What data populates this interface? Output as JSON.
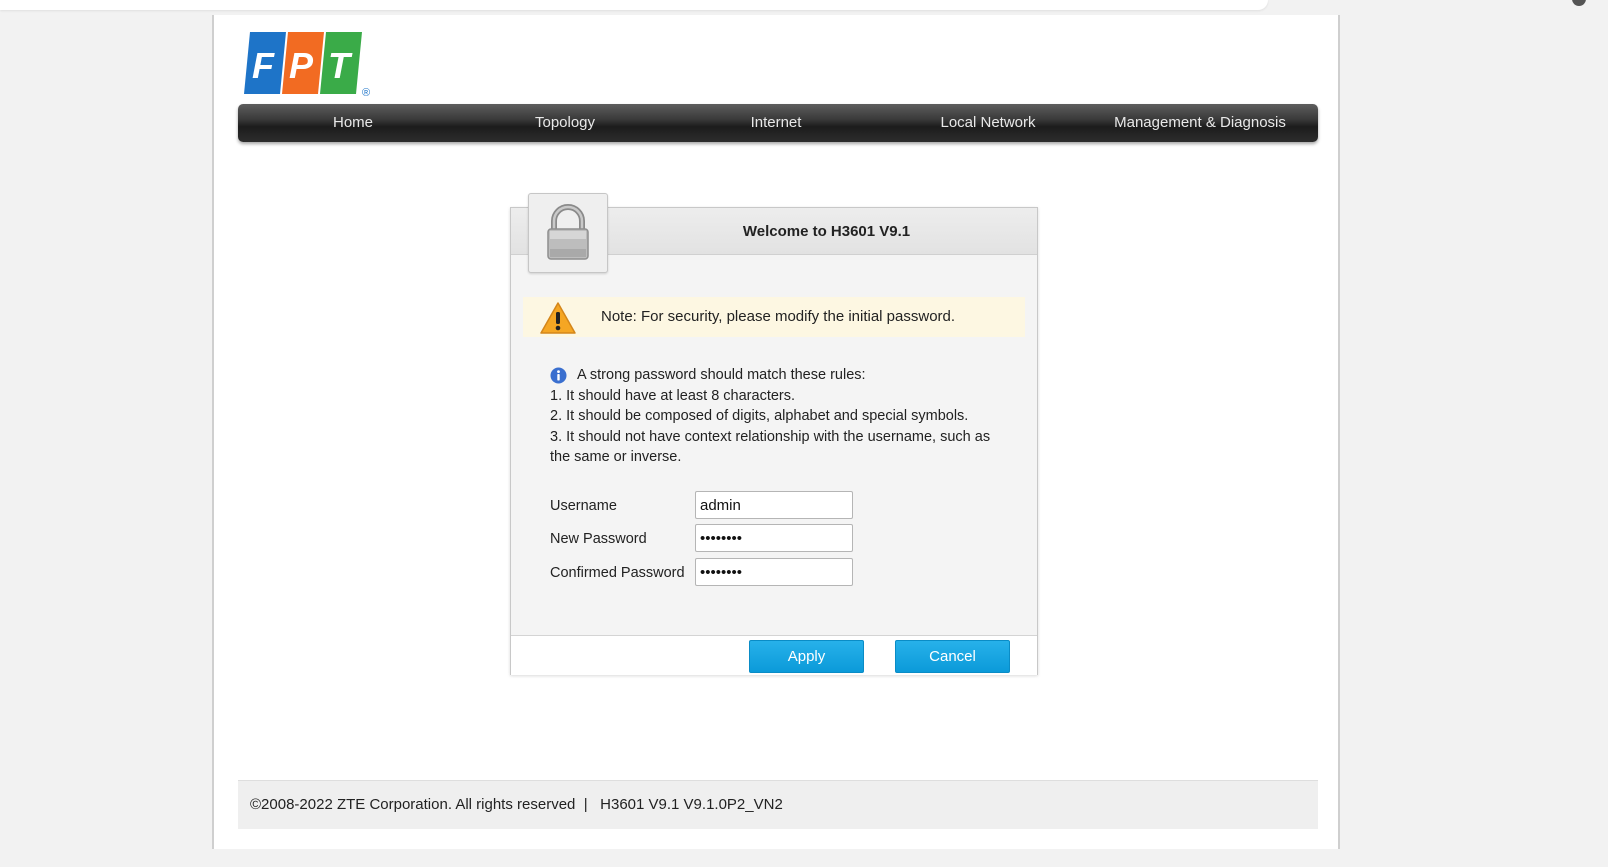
{
  "brand": {
    "logo_letters": [
      "F",
      "P",
      "T"
    ],
    "logo_mark": "®",
    "colors": [
      "#1e74c8",
      "#f26b22",
      "#3aab48"
    ]
  },
  "nav": {
    "items": [
      "Home",
      "Topology",
      "Internet",
      "Local Network",
      "Management & Diagnosis"
    ]
  },
  "dialog": {
    "title": "Welcome to H3601 V9.1",
    "icon": "lock-icon",
    "note": "Note: For security, please modify the initial password.",
    "rules": {
      "heading": "A strong password should match these rules:",
      "items": [
        "1. It should have at least 8 characters.",
        "2. It should be composed of digits, alphabet and special symbols.",
        "3. It should not have context relationship with the username, such as the same or inverse."
      ]
    },
    "fields": {
      "username": {
        "label": "Username",
        "value": "admin"
      },
      "new_password": {
        "label": "New Password",
        "value": "••••••••"
      },
      "confirm_password": {
        "label": "Confirmed Password",
        "value": "••••••••"
      }
    },
    "buttons": {
      "apply": "Apply",
      "cancel": "Cancel"
    },
    "accent_color": "#0b9ad9"
  },
  "footer": {
    "copyright": "©2008-2022 ZTE Corporation. All rights reserved",
    "separator": "|",
    "version": "H3601 V9.1 V9.1.0P2_VN2"
  }
}
